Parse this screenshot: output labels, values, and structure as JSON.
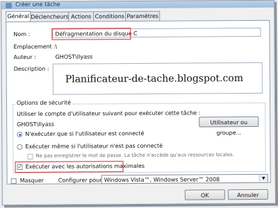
{
  "window": {
    "title": "Créer une tâche"
  },
  "tabs": [
    {
      "label": "Général"
    },
    {
      "label": "Déclencheurs"
    },
    {
      "label": "Actions"
    },
    {
      "label": "Conditions"
    },
    {
      "label": "Paramètres"
    }
  ],
  "general": {
    "name_label": "Nom :",
    "name_value": "Défragmentation du disque C",
    "location_label": "Emplacement :",
    "location_value": "\\",
    "author_label": "Auteur :",
    "author_value": "GHOST\\Ilyass",
    "description_label": "Description :",
    "watermark": "Planificateur-de-tache.blogspot.com"
  },
  "security": {
    "group_label": "Options de sécurité",
    "account_prompt": "Utiliser le compte d'utilisateur suivant pour exécuter cette tâche :",
    "account_value": "GHOST\\Ilyass",
    "user_button": "Utilisateur ou groupe...",
    "radio_logged_on": "N'exécuter que si l'utilisateur est connecté",
    "radio_always": "Exécuter même si l'utilisateur n'est pas connecté",
    "no_store_password": "Ne pas enregistrer le mot de passe. La tâche n'accède qu'aux ressources locales.",
    "highest_privileges": "Exécuter avec les autorisations maximales"
  },
  "footer": {
    "hidden_label": "Masquer",
    "configure_label": "Configurer pour :",
    "configure_value": "Windows Vista™, Windows Server™ 2008",
    "ok_button": "OK",
    "cancel_button": "Annuler"
  },
  "colors": {
    "highlight_border": "#d9252b",
    "title_gradient": "#b9d1ea"
  }
}
